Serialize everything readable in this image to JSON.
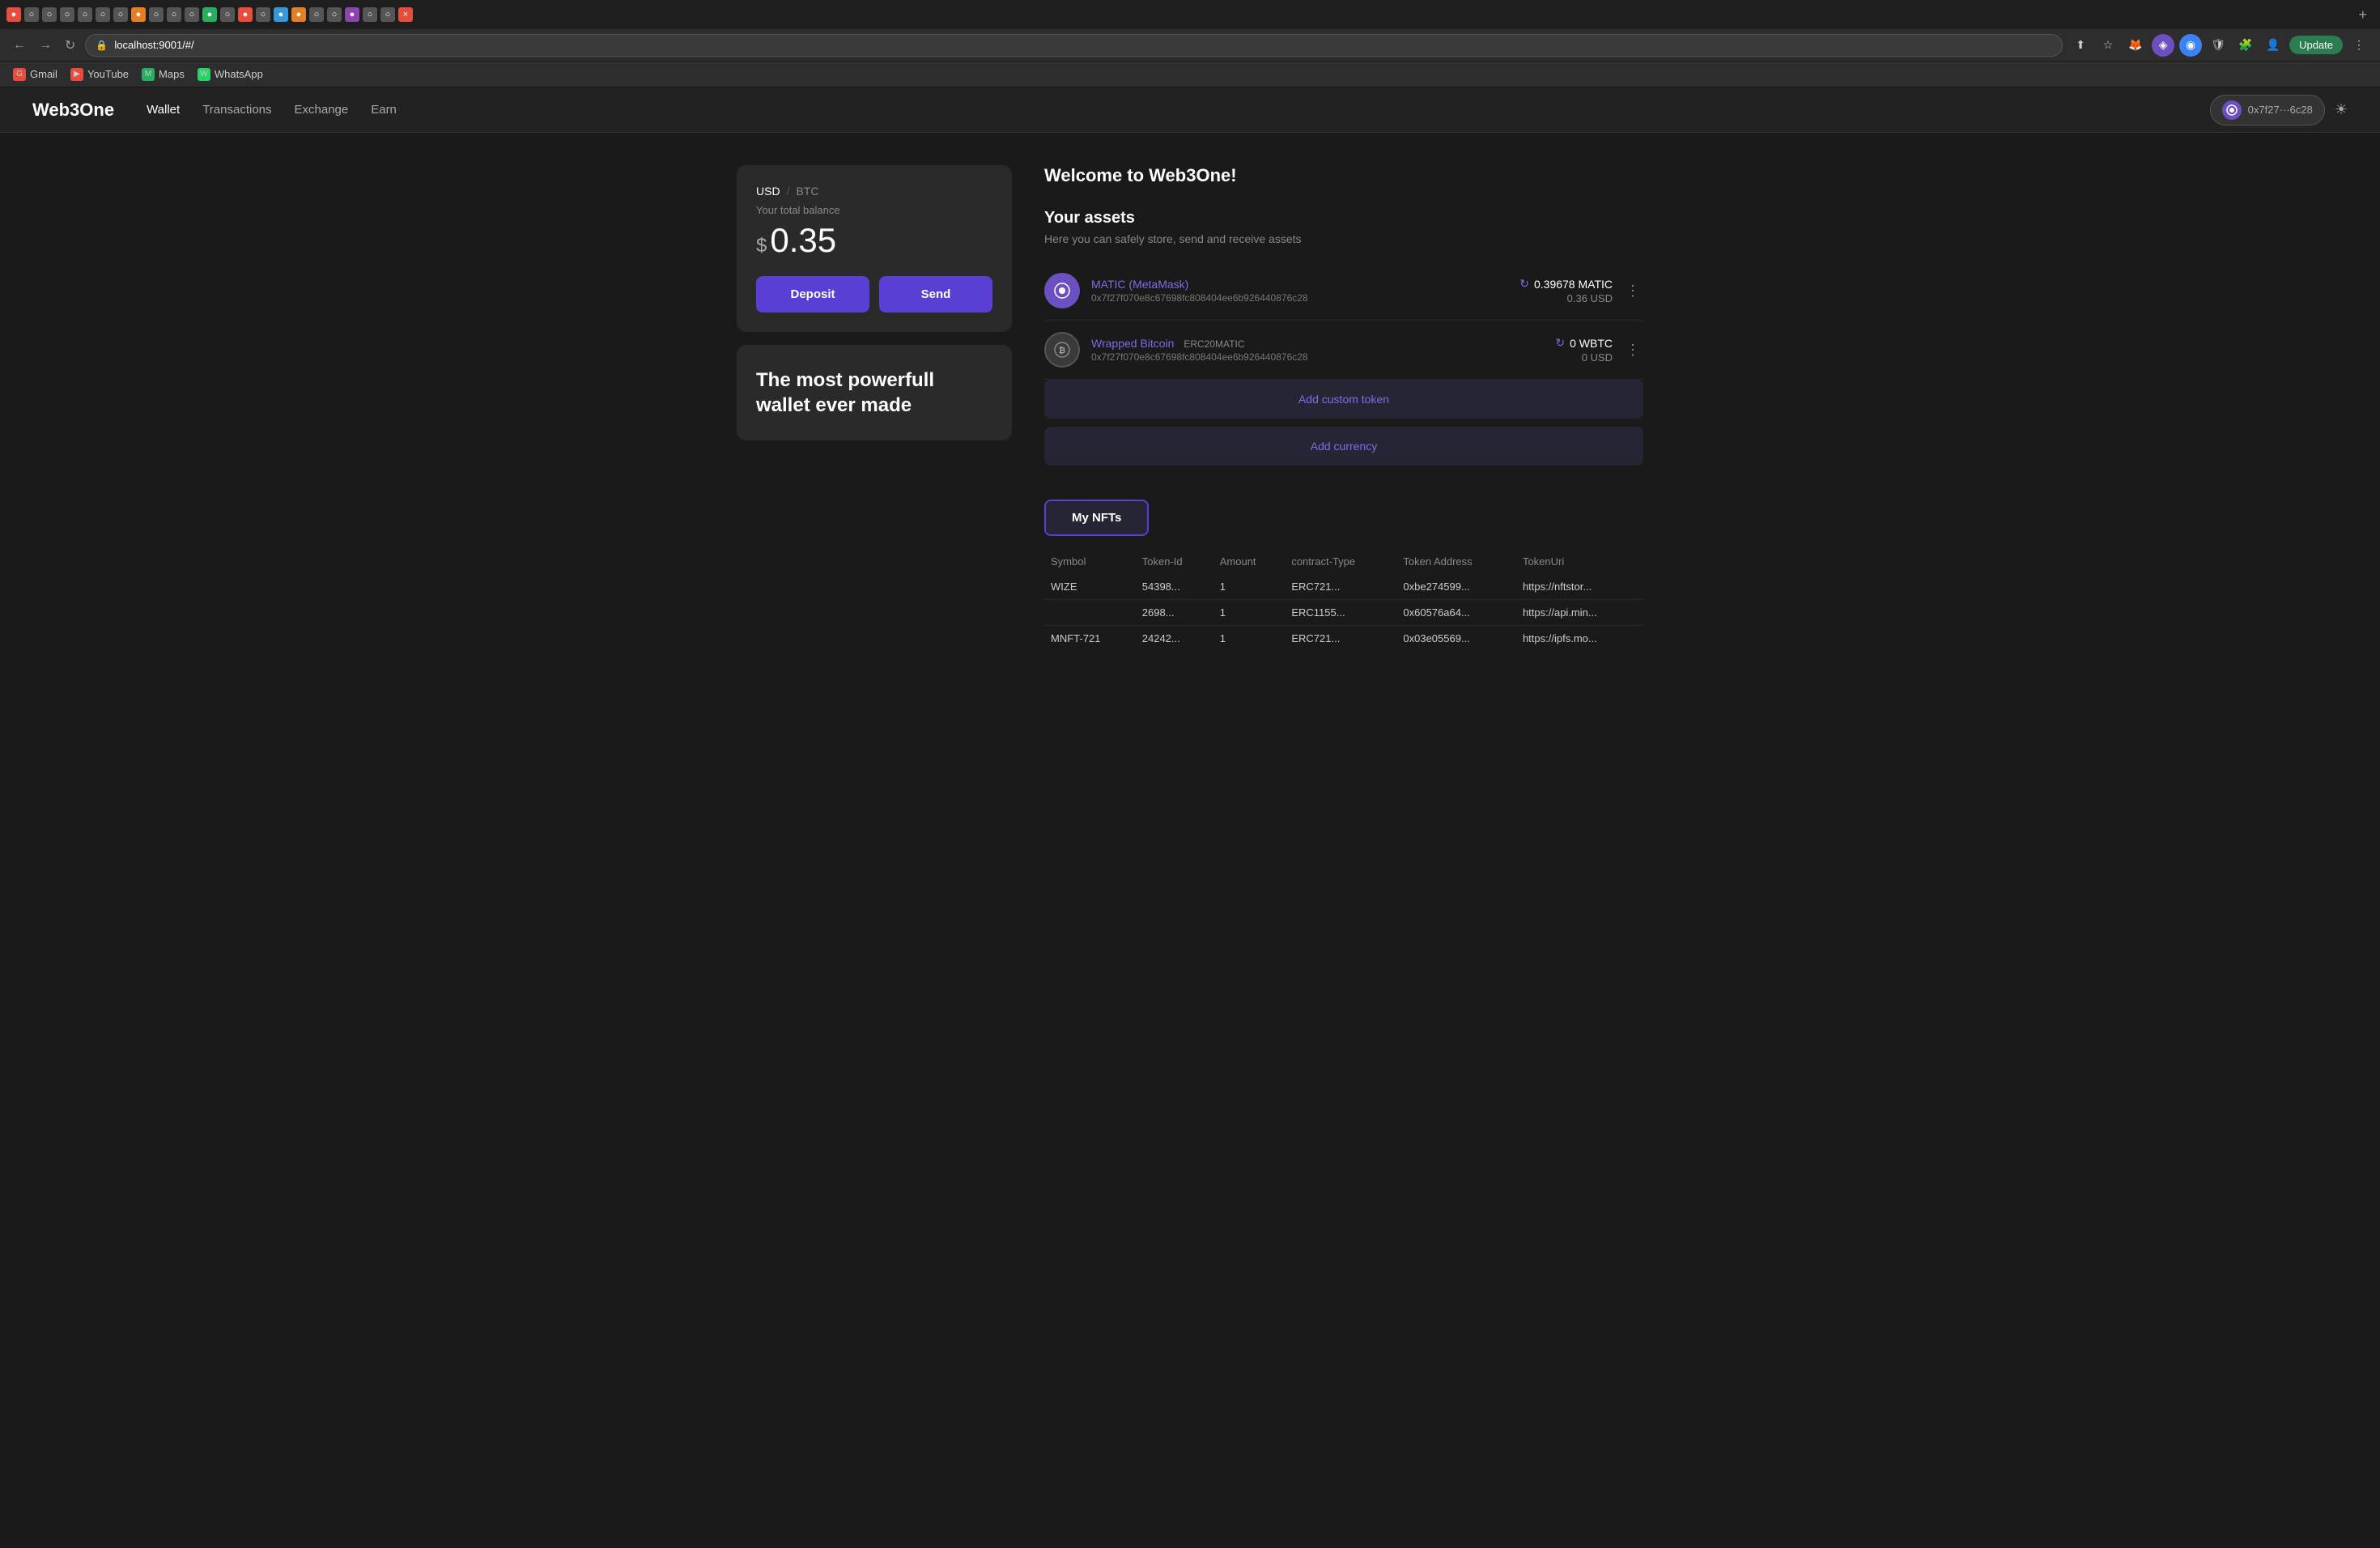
{
  "browser": {
    "address": "localhost:9001/#/",
    "back_label": "←",
    "forward_label": "→",
    "reload_label": "↻",
    "update_btn": "Update",
    "bookmarks": [
      {
        "id": "gmail",
        "label": "Gmail",
        "icon_color": "red",
        "icon_text": "G"
      },
      {
        "id": "youtube",
        "label": "YouTube",
        "icon_color": "red",
        "icon_text": "▶"
      },
      {
        "id": "maps",
        "label": "Maps",
        "icon_color": "green",
        "icon_text": "M"
      },
      {
        "id": "whatsapp",
        "label": "WhatsApp",
        "icon_color": "whatsapp",
        "icon_text": "W"
      }
    ]
  },
  "nav": {
    "logo": "Web3One",
    "links": [
      {
        "id": "wallet",
        "label": "Wallet",
        "active": true
      },
      {
        "id": "transactions",
        "label": "Transactions",
        "active": false
      },
      {
        "id": "exchange",
        "label": "Exchange",
        "active": false
      },
      {
        "id": "earn",
        "label": "Earn",
        "active": false
      }
    ],
    "wallet_address": "0x7f27···6c28"
  },
  "balance": {
    "currency_usd": "USD",
    "currency_btc": "BTC",
    "separator": "/",
    "total_label": "Your total balance",
    "dollar_sign": "$",
    "amount": "0.35",
    "deposit_btn": "Deposit",
    "send_btn": "Send"
  },
  "tagline": "The most powerfull wallet ever made",
  "main": {
    "welcome": "Welcome to Web3One!",
    "assets_title": "Your assets",
    "assets_subtitle": "Here you can safely store, send and receive assets",
    "assets": [
      {
        "id": "matic",
        "name": "MATIC (MetaMask)",
        "token_type": "",
        "address": "0x7f27f070e8c67698fc808404ee6b926440876c28",
        "balance_crypto": "0.39678 MATIC",
        "balance_usd": "0.36  USD",
        "icon_text": "🔗"
      },
      {
        "id": "wbtc",
        "name": "Wrapped Bitcoin",
        "token_type": "ERC20MATIC",
        "address": "0x7f27f070e8c67698fc808404ee6b926440876c28",
        "balance_crypto": "0 WBTC",
        "balance_usd": "0  USD",
        "icon_text": "₿"
      }
    ],
    "add_custom_token_btn": "Add custom token",
    "add_currency_btn": "Add currency",
    "nft_tab": "My NFTs",
    "nft_columns": [
      "Symbol",
      "Token-Id",
      "Amount",
      "contract-Type",
      "Token Address",
      "TokenUri"
    ],
    "nft_rows": [
      {
        "symbol": "WIZE",
        "token_id": "54398...",
        "amount": "1",
        "contract_type": "ERC721...",
        "token_address": "0xbe274599...",
        "token_uri": "https://nftstor..."
      },
      {
        "symbol": "",
        "token_id": "2698...",
        "amount": "1",
        "contract_type": "ERC1155...",
        "token_address": "0x60576a64...",
        "token_uri": "https://api.min..."
      },
      {
        "symbol": "MNFT-721",
        "token_id": "24242...",
        "amount": "1",
        "contract_type": "ERC721...",
        "token_address": "0x03e05569...",
        "token_uri": "https://ipfs.mo..."
      }
    ]
  }
}
